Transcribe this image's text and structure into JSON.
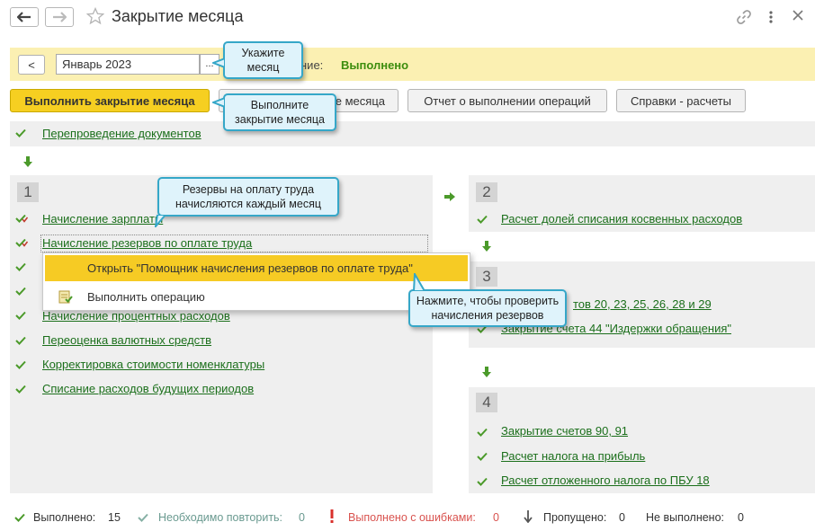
{
  "window": {
    "title": "Закрытие месяца"
  },
  "band": {
    "prev_label": "<",
    "month_value": "Январь 2023",
    "month_picker": "...",
    "state_label": "ние:",
    "state_value": "Выполнено"
  },
  "toolbar": {
    "close_month": "Выполнить закрытие месяца",
    "second_button_tail": "е месяца",
    "report": "Отчет о выполнении операций",
    "calc": "Справки - расчеты"
  },
  "pre_operation": "Перепроведение документов",
  "groups": [
    {
      "number": "1",
      "operations": [
        {
          "label": "Начисление зарплаты",
          "status": "done"
        },
        {
          "label": "Начисление резервов по оплате труда",
          "status": "done"
        },
        {
          "label": "",
          "status": "done"
        },
        {
          "label": "",
          "status": "done"
        },
        {
          "label": "Начисление процентных расходов",
          "status": "done"
        },
        {
          "label": "Переоценка валютных средств",
          "status": "done"
        },
        {
          "label": "Корректировка стоимости номенклатуры",
          "status": "done"
        },
        {
          "label": "Списание расходов будущих периодов",
          "status": "done"
        }
      ]
    },
    {
      "number": "2",
      "operations": [
        {
          "label": "Расчет долей списания косвенных расходов",
          "status": "done"
        }
      ]
    },
    {
      "number": "3",
      "operations": [
        {
          "label": "тов 20, 23, 25, 26, 28 и 29",
          "status": "done"
        },
        {
          "label": "Закрытие счета 44 \"Издержки обращения\"",
          "status": "done"
        }
      ]
    },
    {
      "number": "4",
      "operations": [
        {
          "label": "Закрытие счетов 90, 91",
          "status": "done"
        },
        {
          "label": "Расчет налога на прибыль",
          "status": "done"
        },
        {
          "label": "Расчет отложенного налога по ПБУ 18",
          "status": "done"
        }
      ]
    }
  ],
  "context_menu": {
    "items": [
      {
        "label": "Открыть \"Помощник начисления резервов по оплате труда\""
      },
      {
        "label": "Выполнить операцию"
      }
    ]
  },
  "callouts": {
    "month": "Укажите\nмесяц",
    "close": "Выполните\nзакрытие месяца",
    "reserves": "Резервы на оплату труда\nначисляются каждый месяц",
    "check": "Нажмите, чтобы проверить\nначисления резервов"
  },
  "status_bar": {
    "done_label": "Выполнено:",
    "done_count": "15",
    "repeat_label": "Необходимо повторить:",
    "repeat_count": "0",
    "errors_label": "Выполнено с ошибками:",
    "errors_count": "0",
    "skipped_label": "Пропущено:",
    "skipped_count": "0",
    "notdone_label": "Не выполнено:",
    "notdone_count": "0"
  },
  "colors": {
    "accent_yellow": "#f6cf21",
    "link_green": "#1b6f1b",
    "check_green": "#4b9a2a",
    "callout_border": "#35a7c8"
  }
}
